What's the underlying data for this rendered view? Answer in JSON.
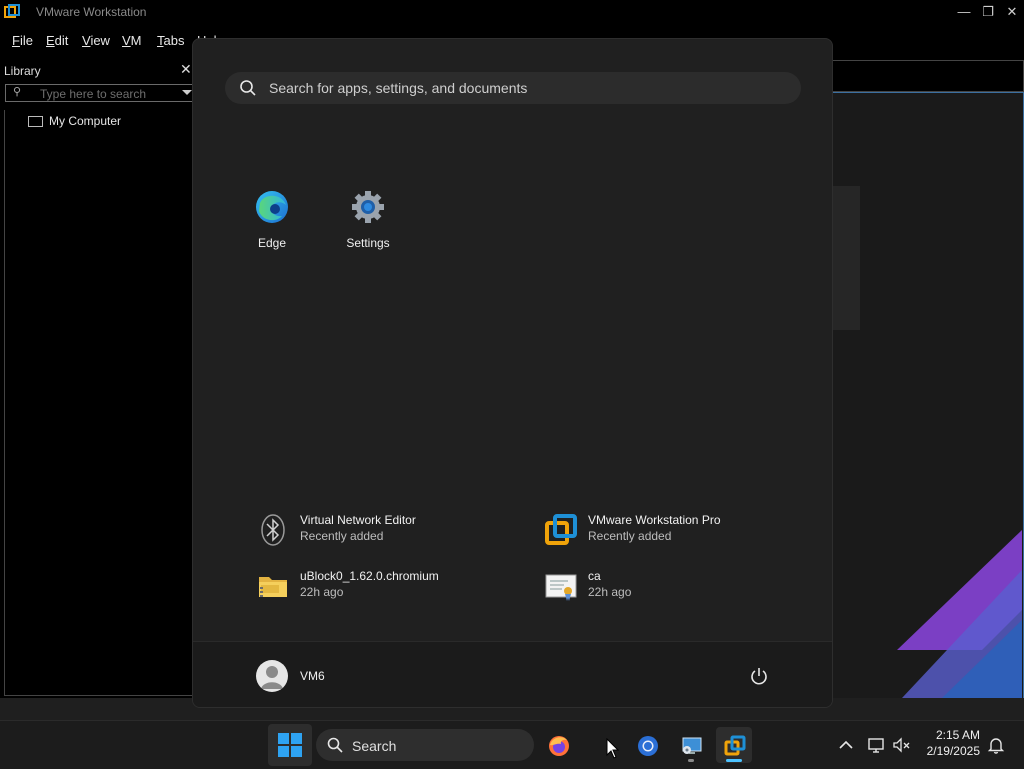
{
  "window": {
    "title": "VMware Workstation",
    "controls": {
      "minimize": "—",
      "restore": "❐",
      "close": "✕"
    }
  },
  "menubar": {
    "items": [
      "File",
      "Edit",
      "View",
      "VM",
      "Tabs",
      "Help"
    ]
  },
  "library": {
    "title": "Library",
    "close": "✕",
    "search_placeholder": "Type here to search",
    "tree": [
      {
        "label": "My Computer",
        "icon": "computer-icon"
      }
    ]
  },
  "start_menu": {
    "search_placeholder": "Search for apps, settings, and documents",
    "pinned": [
      {
        "label": "Edge",
        "icon": "edge-icon"
      },
      {
        "label": "Settings",
        "icon": "settings-gear-icon"
      }
    ],
    "recommended": [
      {
        "name": "Virtual Network Editor",
        "sub": "Recently added",
        "icon": "bluetooth-icon"
      },
      {
        "name": "VMware Workstation Pro",
        "sub": "Recently added",
        "icon": "vmware-icon"
      },
      {
        "name": "uBlock0_1.62.0.chromium",
        "sub": "22h ago",
        "icon": "zip-folder-icon"
      },
      {
        "name": "ca",
        "sub": "22h ago",
        "icon": "certificate-icon"
      }
    ],
    "user": {
      "name": "VM6",
      "icon": "user-avatar-icon"
    },
    "power_icon": "power-icon"
  },
  "taskbar": {
    "search_label": "Search",
    "apps": [
      {
        "name": "firefox",
        "icon": "firefox-icon"
      },
      {
        "name": "chrome",
        "icon": "chrome-icon"
      },
      {
        "name": "control-panel",
        "icon": "control-panel-icon"
      },
      {
        "name": "vmware",
        "icon": "vmware-icon"
      }
    ],
    "tray": [
      "chevron-up-icon",
      "network-icon",
      "volume-muted-icon"
    ],
    "clock": {
      "time": "2:15 AM",
      "date": "2/19/2025"
    },
    "notification_icon": "bell-icon"
  },
  "colors": {
    "vmware_orange": "#f0a30a",
    "vmware_blue": "#1e90d6",
    "taskbar": "#1c1c1c",
    "start_bg": "#202020"
  }
}
